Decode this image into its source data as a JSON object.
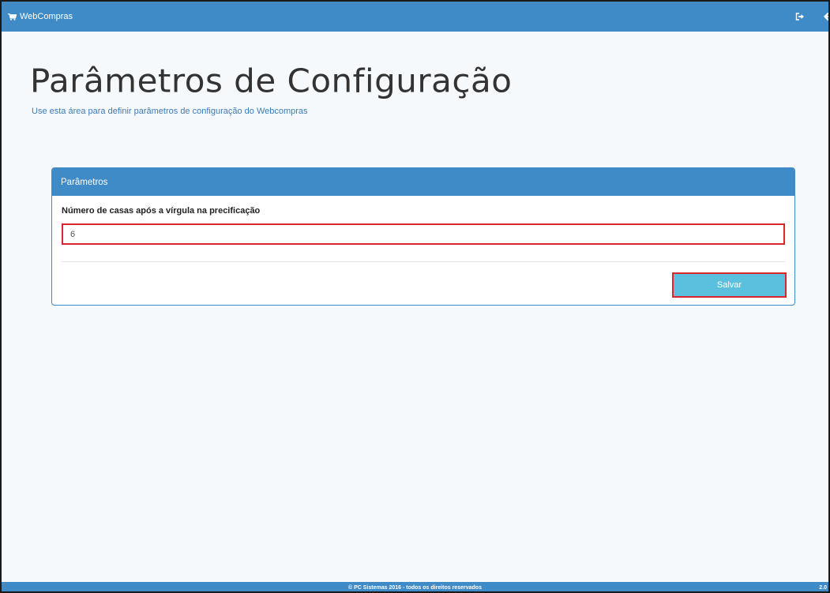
{
  "app": {
    "brand_label": "WebCompras",
    "brand_icon": "shopping-cart-icon",
    "logout_icon": "sign-out-icon",
    "back_icon": "arrow-left-icon",
    "accent_color": "#3f8bc7"
  },
  "page": {
    "title": "Parâmetros de Configuração",
    "subtitle": "Use esta área para definir parâmetros de configuração do Webcompras"
  },
  "panel": {
    "heading": "Parâmetros",
    "field_label": "Número de casas após a vírgula na precificação",
    "field_value": "6",
    "save_label": "Salvar"
  },
  "footer": {
    "copyright": "© PC Sistemas 2016 - todos os direitos reservados",
    "version": "2.0"
  }
}
